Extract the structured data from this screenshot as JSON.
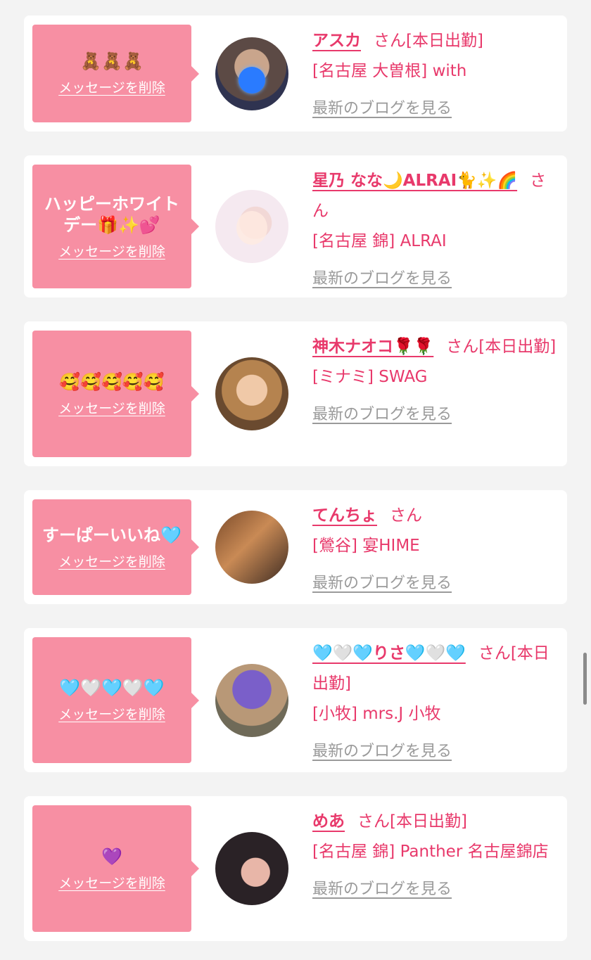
{
  "delete_label": "メッセージを削除",
  "blog_label": "最新のブログを見る",
  "san_label": "さん",
  "cards": [
    {
      "message": "🧸🧸🧸",
      "name": "アスカ",
      "suffix": "さん[本日出勤]",
      "shop_lines": [
        "[名古屋 大曽根] with"
      ],
      "avatar_icon": "portrait-photo"
    },
    {
      "message": "ハッピーホワイトデー🎁✨💕",
      "name": "星乃 なな🌙ALRAI🐈✨🌈",
      "suffix": "さん",
      "shop_lines": [
        "[名古屋 錦] ALRAI"
      ],
      "avatar_icon": "portrait-photo"
    },
    {
      "message": "🥰🥰🥰🥰🥰",
      "name": "神木ナオコ🌹🌹",
      "suffix": "さん[本日出勤]",
      "shop_lines": [
        "[ミナミ] SWAG"
      ],
      "avatar_icon": "portrait-photo"
    },
    {
      "message": "すーぱーいいね🩵",
      "name": "てんちょ",
      "suffix": "さん",
      "shop_lines": [
        "[鶯谷] 宴HIME"
      ],
      "avatar_icon": "group-photo"
    },
    {
      "message": "🩵🤍🩵🤍🩵",
      "name": "🩵🤍🩵りさ🩵🤍🩵",
      "suffix": "さん[本日出勤]",
      "shop_lines": [
        "[小牧] mrs.J 小牧"
      ],
      "avatar_icon": "portrait-photo"
    },
    {
      "message": "💜",
      "name": "めあ",
      "suffix": "さん[本日出勤]",
      "shop_lines": [
        "[名古屋 錦] Panther 名古屋錦店"
      ],
      "avatar_icon": "portrait-photo"
    }
  ],
  "colors": {
    "accent": "#e8396b",
    "bubble": "#f78fa3",
    "link_gray": "#9a9a9a",
    "background": "#f3f3f3"
  }
}
